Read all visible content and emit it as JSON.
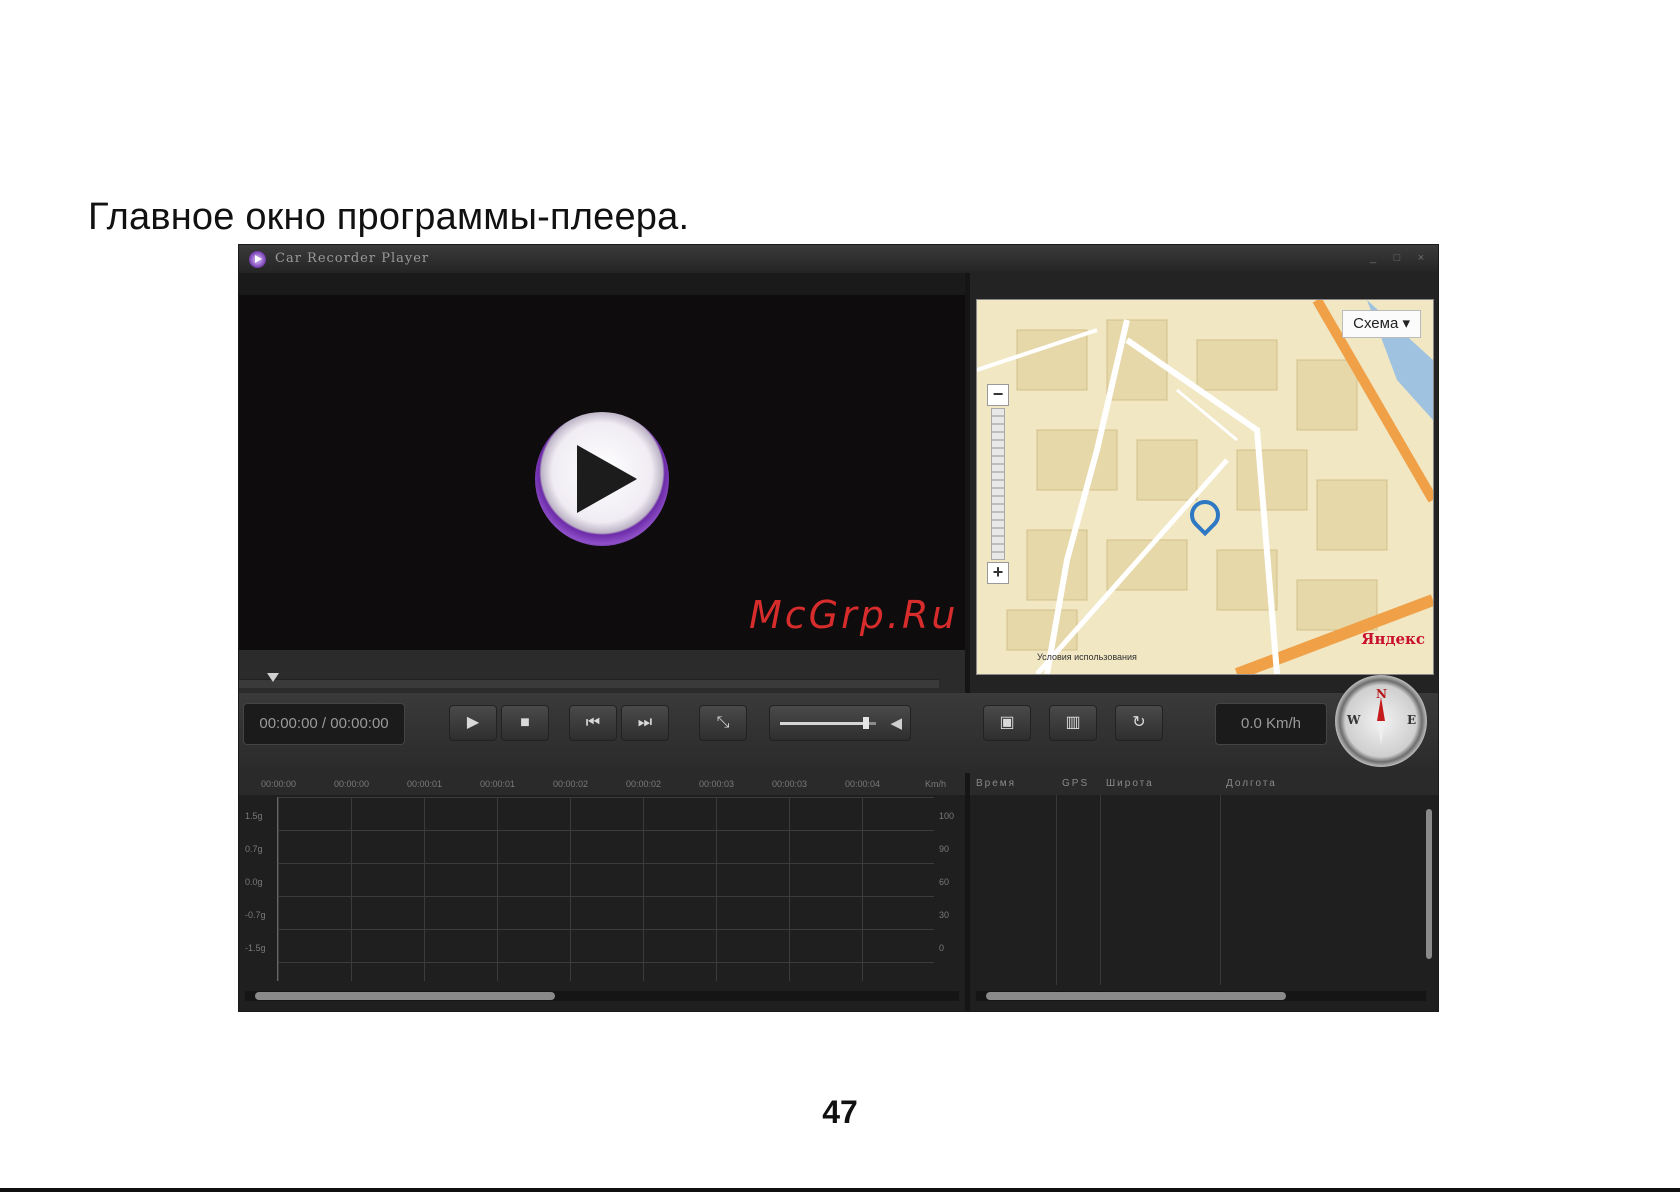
{
  "caption": "Главное окно программы-плеера.",
  "page_number": "47",
  "window": {
    "title": "Car Recorder Player",
    "controls": [
      "_",
      "□",
      "×"
    ]
  },
  "video": {
    "watermark": "McGrp.Ru",
    "play_icon": "play-circle-icon",
    "seek_position": 0.04
  },
  "map": {
    "scheme_button": "Схема ▾",
    "zoom_in": "+",
    "zoom_out": "−",
    "logo": "Яндекс",
    "footer": "Условия использования"
  },
  "controls": {
    "time": "00:00:00 / 00:00:00",
    "speed": "0.0 Km/h",
    "volume_level": 0.9,
    "buttons": {
      "play": "▶",
      "stop": "■",
      "prev": "⏮",
      "next": "⏭",
      "fullscreen": "⤡",
      "snapshot": "▣",
      "delete": "▥",
      "refresh": "↻",
      "volume_icon": "speaker-icon"
    },
    "compass": {
      "n": "N",
      "w": "W",
      "e": "E"
    }
  },
  "graph": {
    "time_ticks": [
      "00:00:00",
      "00:00:00",
      "00:00:01",
      "00:00:01",
      "00:00:02",
      "00:00:02",
      "00:00:03",
      "00:00:03",
      "00:00:04"
    ],
    "unit": "Km/h",
    "y_left": [
      "1.5g",
      "0.7g",
      "0.0g",
      "-0.7g",
      "-1.5g"
    ],
    "y_right": [
      "100",
      "90",
      "60",
      "30",
      "0"
    ]
  },
  "data_table": {
    "columns": [
      "Время",
      "GPS",
      "Широта",
      "Долгота"
    ]
  }
}
